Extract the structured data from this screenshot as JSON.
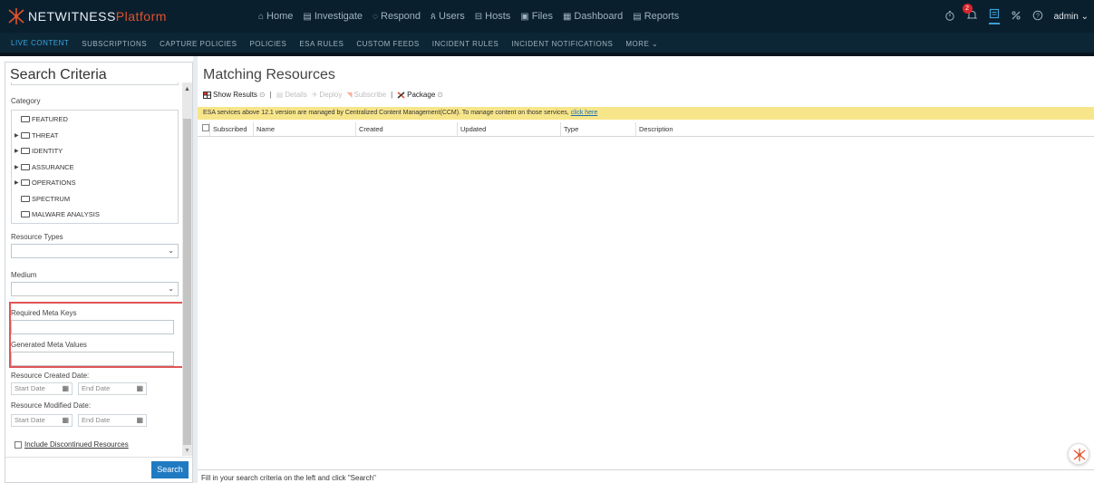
{
  "app": {
    "logo_main": "NETWITNESS",
    "logo_sub": "Platform"
  },
  "mainnav": [
    {
      "label": "Home",
      "icon": "home-icon",
      "glyph": "⌂"
    },
    {
      "label": "Investigate",
      "icon": "investigate-icon",
      "glyph": "▤"
    },
    {
      "label": "Respond",
      "icon": "shield-icon",
      "glyph": "◌"
    },
    {
      "label": "Users",
      "icon": "users-icon",
      "glyph": "ጰ"
    },
    {
      "label": "Hosts",
      "icon": "hosts-icon",
      "glyph": "⊟"
    },
    {
      "label": "Files",
      "icon": "files-icon",
      "glyph": "▣"
    },
    {
      "label": "Dashboard",
      "icon": "dashboard-icon",
      "glyph": "▦"
    },
    {
      "label": "Reports",
      "icon": "reports-icon",
      "glyph": "▤"
    }
  ],
  "topright": {
    "notification_count": "2",
    "admin_label": "admin ⌄"
  },
  "subnav": [
    {
      "label": "LIVE CONTENT",
      "active": true
    },
    {
      "label": "SUBSCRIPTIONS"
    },
    {
      "label": "CAPTURE POLICIES"
    },
    {
      "label": "POLICIES"
    },
    {
      "label": "ESA RULES"
    },
    {
      "label": "CUSTOM FEEDS"
    },
    {
      "label": "INCIDENT RULES"
    },
    {
      "label": "INCIDENT NOTIFICATIONS"
    },
    {
      "label": "MORE ⌄"
    }
  ],
  "search": {
    "title": "Search Criteria",
    "category_label": "Category",
    "categories": [
      {
        "label": "FEATURED",
        "expandable": false
      },
      {
        "label": "THREAT",
        "expandable": true
      },
      {
        "label": "IDENTITY",
        "expandable": true
      },
      {
        "label": "ASSURANCE",
        "expandable": true
      },
      {
        "label": "OPERATIONS",
        "expandable": true
      },
      {
        "label": "SPECTRUM",
        "expandable": false
      },
      {
        "label": "MALWARE ANALYSIS",
        "expandable": false
      }
    ],
    "resource_types_label": "Resource Types",
    "resource_types_value": "",
    "medium_label": "Medium",
    "medium_value": "",
    "required_meta_keys_label": "Required Meta Keys",
    "required_meta_keys_value": "",
    "generated_meta_values_label": "Generated Meta Values",
    "generated_meta_values_value": "",
    "created_date_label": "Resource Created Date:",
    "modified_date_label": "Resource Modified Date:",
    "start_date_placeholder": "Start Date",
    "end_date_placeholder": "End Date",
    "include_discontinued_label": "Include Discontinued Resources",
    "search_button": "Search"
  },
  "results": {
    "title": "Matching Resources",
    "toolbar": {
      "show_results": "Show Results",
      "details": "Details",
      "deploy": "Deploy",
      "subscribe": "Subscribe",
      "package": "Package"
    },
    "notice_text": "ESA services above 12.1 version are managed by Centralized Content Management(CCM). To manage content on those services,",
    "notice_link": "click here",
    "columns": [
      "Subscribed",
      "Name",
      "Created",
      "Updated",
      "Type",
      "Description"
    ],
    "status_text": "Fill in your search criteria on the left and click \"Search\""
  },
  "colors": {
    "topbar_bg": "#0a1f2e",
    "accent": "#39a6e0",
    "brand_orange": "#e0522c",
    "notice_bg": "#f7e58a",
    "search_button": "#1f7ac2",
    "highlight_border": "#e05555"
  }
}
